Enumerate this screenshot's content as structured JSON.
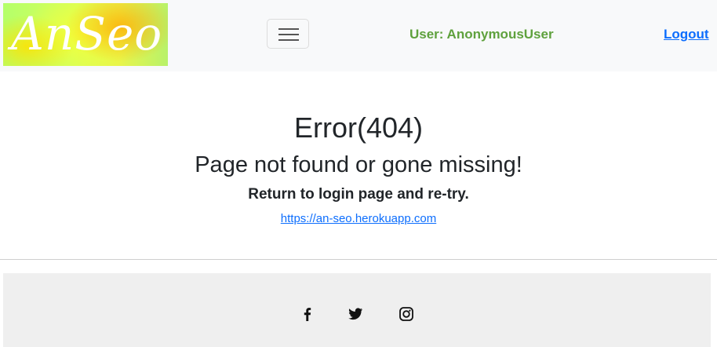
{
  "navbar": {
    "brand_text": "AnSeo",
    "toggler_aria": "Toggle navigation",
    "user_label": "User: AnonymousUser",
    "logout_label": "Logout"
  },
  "main": {
    "title": "Error(404)",
    "subtitle": "Page not found or gone missing!",
    "hint": "Return to login page and re-try.",
    "link_text": "https://an-seo.herokuapp.com"
  },
  "footer": {
    "social": [
      {
        "icon": "facebook-icon"
      },
      {
        "icon": "twitter-icon"
      },
      {
        "icon": "instagram-icon"
      }
    ]
  },
  "colors": {
    "navbar_bg": "#f8f9fa",
    "user_text": "#5fa13d",
    "link": "#0d6efd",
    "footer_bg": "#efefef",
    "text": "#212529"
  }
}
